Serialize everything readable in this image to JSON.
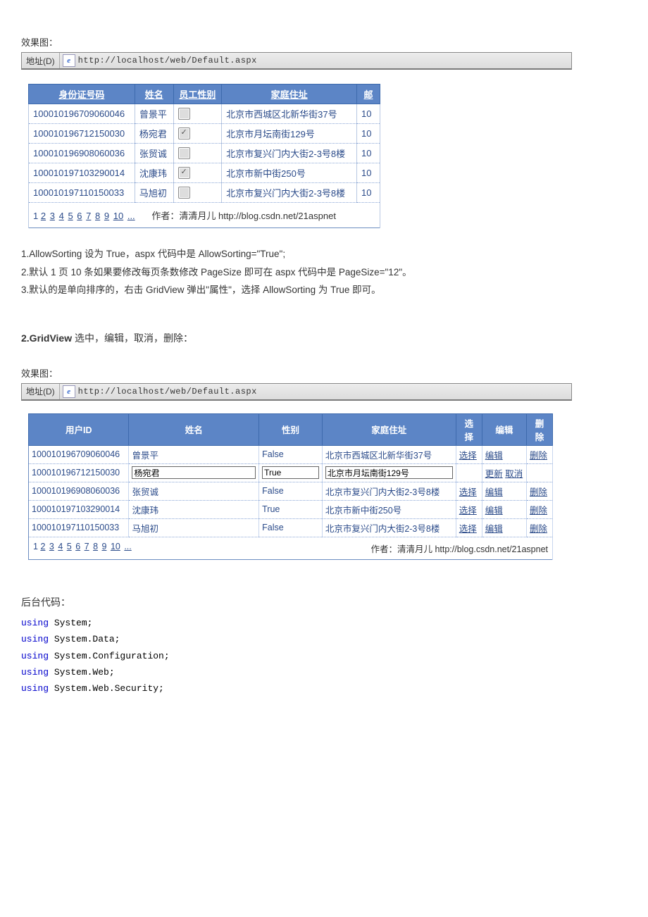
{
  "caption1": "效果图：",
  "addr_label": "地址(D)",
  "addr_url": "http://localhost/web/Default.aspx",
  "ie_icon_glyph": "e",
  "grid1": {
    "headers": [
      "身份证号码",
      "姓名",
      "员工性别",
      "家庭住址",
      "邮"
    ],
    "rows": [
      {
        "id": "100010196709060046",
        "name": "曾景平",
        "checked": false,
        "addr": "北京市西城区北新华街37号",
        "tail": "10"
      },
      {
        "id": "100010196712150030",
        "name": "杨宛君",
        "checked": true,
        "addr": "北京市月坛南街129号",
        "tail": "10"
      },
      {
        "id": "100010196908060036",
        "name": "张贸诚",
        "checked": false,
        "addr": "北京市复兴门内大街2-3号8楼",
        "tail": "10"
      },
      {
        "id": "100010197103290014",
        "name": "沈康玮",
        "checked": true,
        "addr": "北京市新中街250号",
        "tail": "10"
      },
      {
        "id": "100010197110150033",
        "name": "马旭初",
        "checked": false,
        "addr": "北京市复兴门内大街2-3号8楼",
        "tail": "10"
      }
    ],
    "pager": [
      "1",
      "2",
      "3",
      "4",
      "5",
      "6",
      "7",
      "8",
      "9",
      "10",
      "..."
    ],
    "author_label": "作者：清清月儿 http://blog.csdn.net/21aspnet"
  },
  "notes": {
    "n1": "1.AllowSorting 设为 True，aspx 代码中是 AllowSorting=\"True\";",
    "n2": "2.默认 1 页 10 条如果要修改每页条数修改 PageSize 即可在 aspx 代码中是 PageSize=\"12\"。",
    "n3": "3.默认的是单向排序的，右击 GridView 弹出\"属性\"，选择 AllowSorting 为 True 即可。"
  },
  "section2_title_bold": "2.GridView",
  "section2_title_rest": " 选中，编辑，取消，删除：",
  "caption2": "效果图：",
  "grid2": {
    "headers": [
      "用户ID",
      "姓名",
      "性别",
      "家庭住址",
      "选择",
      "编辑",
      "删除"
    ],
    "rows": [
      {
        "id": "100010196709060046",
        "name": "曾景平",
        "sex": "False",
        "addr": "北京市西城区北新华街37号",
        "sel": "选择",
        "edit": "编辑",
        "del": "删除",
        "editing": false
      },
      {
        "id": "100010196712150030",
        "name": "杨宛君",
        "sex": "True",
        "addr": "北京市月坛南街129号",
        "sel": "",
        "edit": "更新 取消",
        "del": "",
        "editing": true
      },
      {
        "id": "100010196908060036",
        "name": "张贸诚",
        "sex": "False",
        "addr": "北京市复兴门内大街2-3号8楼",
        "sel": "选择",
        "edit": "编辑",
        "del": "删除",
        "editing": false
      },
      {
        "id": "100010197103290014",
        "name": "沈康玮",
        "sex": "True",
        "addr": "北京市新中街250号",
        "sel": "选择",
        "edit": "编辑",
        "del": "删除",
        "editing": false
      },
      {
        "id": "100010197110150033",
        "name": "马旭初",
        "sex": "False",
        "addr": "北京市复兴门内大街2-3号8楼",
        "sel": "选择",
        "edit": "编辑",
        "del": "删除",
        "editing": false
      }
    ],
    "pager": [
      "1",
      "2",
      "3",
      "4",
      "5",
      "6",
      "7",
      "8",
      "9",
      "10",
      "..."
    ],
    "author_label": "作者：清清月儿 http://blog.csdn.net/21aspnet"
  },
  "code_header": "后台代码：",
  "code_lines": [
    {
      "kw": "using",
      "rest": " System;"
    },
    {
      "kw": "using",
      "rest": " System.Data;"
    },
    {
      "kw": "using",
      "rest": " System.Configuration;"
    },
    {
      "kw": "using",
      "rest": " System.Web;"
    },
    {
      "kw": "using",
      "rest": " System.Web.Security;"
    }
  ]
}
